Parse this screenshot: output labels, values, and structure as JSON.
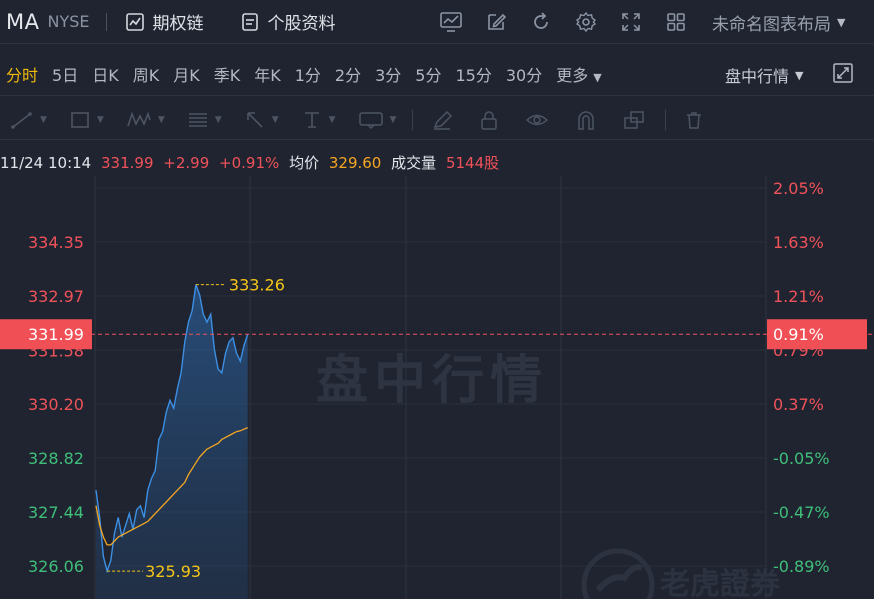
{
  "header": {
    "symbol": "MA",
    "exchange": "NYSE",
    "options_chain": "期权链",
    "stock_info": "个股资料",
    "layout_name": "未命名图表布局"
  },
  "periods": {
    "tabs": [
      "分时",
      "5日",
      "日K",
      "周K",
      "月K",
      "季K",
      "年K",
      "1分",
      "2分",
      "3分",
      "5分",
      "15分",
      "30分"
    ],
    "active": "分时",
    "more_label": "更多",
    "mode_label": "盘中行情"
  },
  "info": {
    "datetime": "11/24 10:14",
    "price": "331.99",
    "change": "+2.99",
    "change_pct": "+0.91%",
    "avg_label": "均价",
    "avg_value": "329.60",
    "volume_label": "成交量",
    "volume_value": "5144股"
  },
  "chart_data": {
    "type": "line",
    "title": "",
    "watermark": "盘中行情",
    "logo": "老虎證券",
    "y_ticks_left": [
      "334.35",
      "332.97",
      "331.58",
      "330.20",
      "328.82",
      "327.44",
      "326.06"
    ],
    "y_ticks_right": [
      "2.05%",
      "1.63%",
      "1.21%",
      "0.79%",
      "0.37%",
      "-0.05%",
      "-0.47%",
      "-0.89%"
    ],
    "ylim": [
      326.06,
      335.73
    ],
    "current_price_label": "331.99",
    "current_pct_label": "0.91%",
    "high_label": "333.26",
    "low_label": "325.93",
    "series": [
      {
        "values": [
          328.0,
          327.3,
          326.3,
          325.93,
          326.2,
          326.9,
          327.3,
          326.8,
          327.1,
          327.4,
          327.0,
          327.5,
          327.6,
          327.3,
          328.0,
          328.3,
          328.5,
          329.3,
          329.5,
          330.0,
          330.3,
          330.1,
          330.6,
          331.0,
          331.8,
          332.3,
          332.6,
          333.26,
          333.0,
          332.5,
          332.3,
          332.5,
          331.6,
          331.1,
          331.0,
          331.5,
          331.8,
          331.9,
          331.5,
          331.3,
          331.7,
          331.99
        ],
        "color": "#3c8fe3"
      },
      {
        "values": [
          327.6,
          327.1,
          326.8,
          326.6,
          326.6,
          326.7,
          326.8,
          326.85,
          326.9,
          326.95,
          327.0,
          327.05,
          327.1,
          327.15,
          327.2,
          327.3,
          327.4,
          327.5,
          327.6,
          327.7,
          327.8,
          327.9,
          328.0,
          328.1,
          328.2,
          328.4,
          328.55,
          328.7,
          328.85,
          328.95,
          329.05,
          329.1,
          329.15,
          329.2,
          329.3,
          329.35,
          329.4,
          329.45,
          329.5,
          329.52,
          329.56,
          329.6
        ],
        "color": "#f5a623"
      }
    ]
  }
}
